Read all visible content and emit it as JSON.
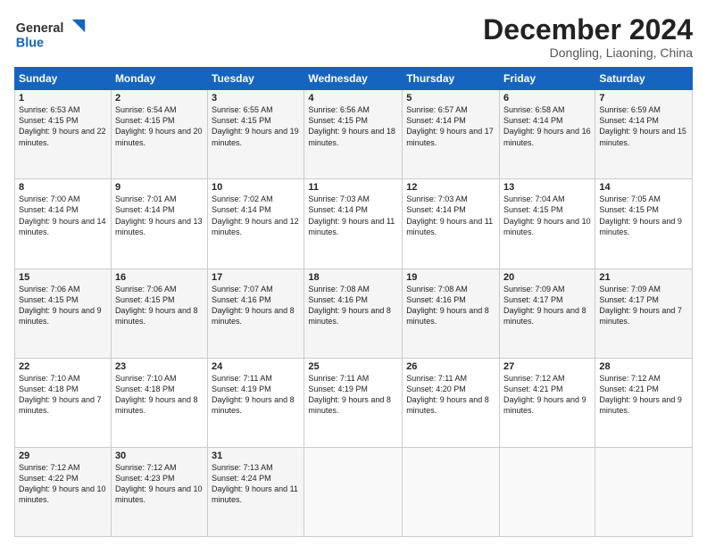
{
  "header": {
    "logo_line1": "General",
    "logo_line2": "Blue",
    "month": "December 2024",
    "location": "Dongling, Liaoning, China"
  },
  "weekdays": [
    "Sunday",
    "Monday",
    "Tuesday",
    "Wednesday",
    "Thursday",
    "Friday",
    "Saturday"
  ],
  "weeks": [
    [
      {
        "day": "1",
        "sunrise": "6:53 AM",
        "sunset": "4:15 PM",
        "daylight": "9 hours and 22 minutes."
      },
      {
        "day": "2",
        "sunrise": "6:54 AM",
        "sunset": "4:15 PM",
        "daylight": "9 hours and 20 minutes."
      },
      {
        "day": "3",
        "sunrise": "6:55 AM",
        "sunset": "4:15 PM",
        "daylight": "9 hours and 19 minutes."
      },
      {
        "day": "4",
        "sunrise": "6:56 AM",
        "sunset": "4:15 PM",
        "daylight": "9 hours and 18 minutes."
      },
      {
        "day": "5",
        "sunrise": "6:57 AM",
        "sunset": "4:14 PM",
        "daylight": "9 hours and 17 minutes."
      },
      {
        "day": "6",
        "sunrise": "6:58 AM",
        "sunset": "4:14 PM",
        "daylight": "9 hours and 16 minutes."
      },
      {
        "day": "7",
        "sunrise": "6:59 AM",
        "sunset": "4:14 PM",
        "daylight": "9 hours and 15 minutes."
      }
    ],
    [
      {
        "day": "8",
        "sunrise": "7:00 AM",
        "sunset": "4:14 PM",
        "daylight": "9 hours and 14 minutes."
      },
      {
        "day": "9",
        "sunrise": "7:01 AM",
        "sunset": "4:14 PM",
        "daylight": "9 hours and 13 minutes."
      },
      {
        "day": "10",
        "sunrise": "7:02 AM",
        "sunset": "4:14 PM",
        "daylight": "9 hours and 12 minutes."
      },
      {
        "day": "11",
        "sunrise": "7:03 AM",
        "sunset": "4:14 PM",
        "daylight": "9 hours and 11 minutes."
      },
      {
        "day": "12",
        "sunrise": "7:03 AM",
        "sunset": "4:14 PM",
        "daylight": "9 hours and 11 minutes."
      },
      {
        "day": "13",
        "sunrise": "7:04 AM",
        "sunset": "4:15 PM",
        "daylight": "9 hours and 10 minutes."
      },
      {
        "day": "14",
        "sunrise": "7:05 AM",
        "sunset": "4:15 PM",
        "daylight": "9 hours and 9 minutes."
      }
    ],
    [
      {
        "day": "15",
        "sunrise": "7:06 AM",
        "sunset": "4:15 PM",
        "daylight": "9 hours and 9 minutes."
      },
      {
        "day": "16",
        "sunrise": "7:06 AM",
        "sunset": "4:15 PM",
        "daylight": "9 hours and 8 minutes."
      },
      {
        "day": "17",
        "sunrise": "7:07 AM",
        "sunset": "4:16 PM",
        "daylight": "9 hours and 8 minutes."
      },
      {
        "day": "18",
        "sunrise": "7:08 AM",
        "sunset": "4:16 PM",
        "daylight": "9 hours and 8 minutes."
      },
      {
        "day": "19",
        "sunrise": "7:08 AM",
        "sunset": "4:16 PM",
        "daylight": "9 hours and 8 minutes."
      },
      {
        "day": "20",
        "sunrise": "7:09 AM",
        "sunset": "4:17 PM",
        "daylight": "9 hours and 8 minutes."
      },
      {
        "day": "21",
        "sunrise": "7:09 AM",
        "sunset": "4:17 PM",
        "daylight": "9 hours and 7 minutes."
      }
    ],
    [
      {
        "day": "22",
        "sunrise": "7:10 AM",
        "sunset": "4:18 PM",
        "daylight": "9 hours and 7 minutes."
      },
      {
        "day": "23",
        "sunrise": "7:10 AM",
        "sunset": "4:18 PM",
        "daylight": "9 hours and 8 minutes."
      },
      {
        "day": "24",
        "sunrise": "7:11 AM",
        "sunset": "4:19 PM",
        "daylight": "9 hours and 8 minutes."
      },
      {
        "day": "25",
        "sunrise": "7:11 AM",
        "sunset": "4:19 PM",
        "daylight": "9 hours and 8 minutes."
      },
      {
        "day": "26",
        "sunrise": "7:11 AM",
        "sunset": "4:20 PM",
        "daylight": "9 hours and 8 minutes."
      },
      {
        "day": "27",
        "sunrise": "7:12 AM",
        "sunset": "4:21 PM",
        "daylight": "9 hours and 9 minutes."
      },
      {
        "day": "28",
        "sunrise": "7:12 AM",
        "sunset": "4:21 PM",
        "daylight": "9 hours and 9 minutes."
      }
    ],
    [
      {
        "day": "29",
        "sunrise": "7:12 AM",
        "sunset": "4:22 PM",
        "daylight": "9 hours and 10 minutes."
      },
      {
        "day": "30",
        "sunrise": "7:12 AM",
        "sunset": "4:23 PM",
        "daylight": "9 hours and 10 minutes."
      },
      {
        "day": "31",
        "sunrise": "7:13 AM",
        "sunset": "4:24 PM",
        "daylight": "9 hours and 11 minutes."
      },
      null,
      null,
      null,
      null
    ]
  ]
}
